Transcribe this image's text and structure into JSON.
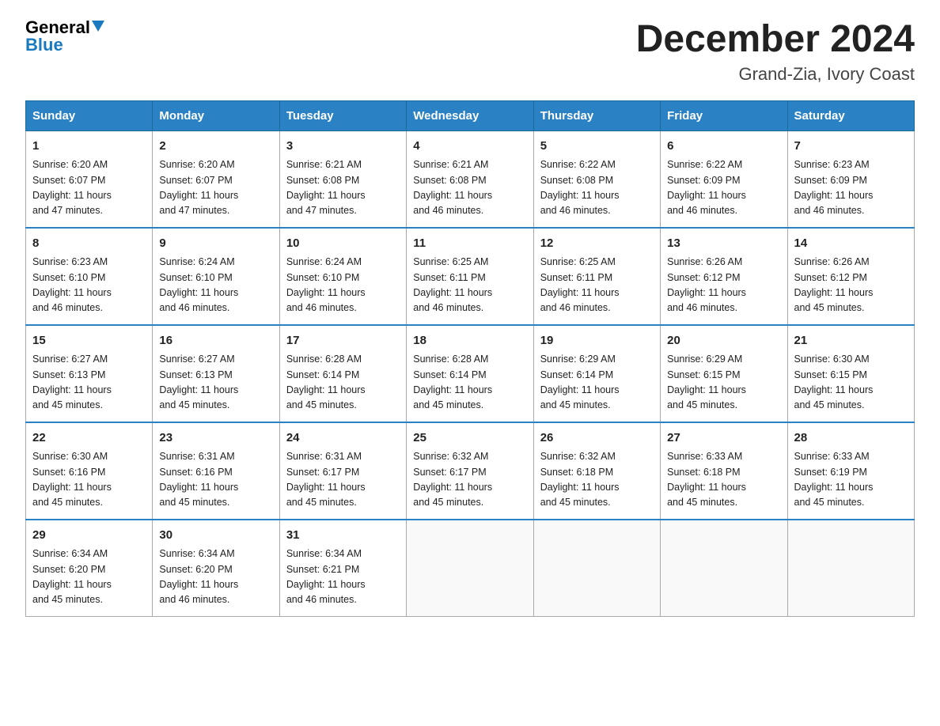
{
  "header": {
    "logo_general": "General",
    "logo_blue": "Blue",
    "month_title": "December 2024",
    "location": "Grand-Zia, Ivory Coast"
  },
  "weekdays": [
    "Sunday",
    "Monday",
    "Tuesday",
    "Wednesday",
    "Thursday",
    "Friday",
    "Saturday"
  ],
  "weeks": [
    [
      {
        "day": "1",
        "sunrise": "6:20 AM",
        "sunset": "6:07 PM",
        "daylight": "11 hours and 47 minutes."
      },
      {
        "day": "2",
        "sunrise": "6:20 AM",
        "sunset": "6:07 PM",
        "daylight": "11 hours and 47 minutes."
      },
      {
        "day": "3",
        "sunrise": "6:21 AM",
        "sunset": "6:08 PM",
        "daylight": "11 hours and 47 minutes."
      },
      {
        "day": "4",
        "sunrise": "6:21 AM",
        "sunset": "6:08 PM",
        "daylight": "11 hours and 46 minutes."
      },
      {
        "day": "5",
        "sunrise": "6:22 AM",
        "sunset": "6:08 PM",
        "daylight": "11 hours and 46 minutes."
      },
      {
        "day": "6",
        "sunrise": "6:22 AM",
        "sunset": "6:09 PM",
        "daylight": "11 hours and 46 minutes."
      },
      {
        "day": "7",
        "sunrise": "6:23 AM",
        "sunset": "6:09 PM",
        "daylight": "11 hours and 46 minutes."
      }
    ],
    [
      {
        "day": "8",
        "sunrise": "6:23 AM",
        "sunset": "6:10 PM",
        "daylight": "11 hours and 46 minutes."
      },
      {
        "day": "9",
        "sunrise": "6:24 AM",
        "sunset": "6:10 PM",
        "daylight": "11 hours and 46 minutes."
      },
      {
        "day": "10",
        "sunrise": "6:24 AM",
        "sunset": "6:10 PM",
        "daylight": "11 hours and 46 minutes."
      },
      {
        "day": "11",
        "sunrise": "6:25 AM",
        "sunset": "6:11 PM",
        "daylight": "11 hours and 46 minutes."
      },
      {
        "day": "12",
        "sunrise": "6:25 AM",
        "sunset": "6:11 PM",
        "daylight": "11 hours and 46 minutes."
      },
      {
        "day": "13",
        "sunrise": "6:26 AM",
        "sunset": "6:12 PM",
        "daylight": "11 hours and 46 minutes."
      },
      {
        "day": "14",
        "sunrise": "6:26 AM",
        "sunset": "6:12 PM",
        "daylight": "11 hours and 45 minutes."
      }
    ],
    [
      {
        "day": "15",
        "sunrise": "6:27 AM",
        "sunset": "6:13 PM",
        "daylight": "11 hours and 45 minutes."
      },
      {
        "day": "16",
        "sunrise": "6:27 AM",
        "sunset": "6:13 PM",
        "daylight": "11 hours and 45 minutes."
      },
      {
        "day": "17",
        "sunrise": "6:28 AM",
        "sunset": "6:14 PM",
        "daylight": "11 hours and 45 minutes."
      },
      {
        "day": "18",
        "sunrise": "6:28 AM",
        "sunset": "6:14 PM",
        "daylight": "11 hours and 45 minutes."
      },
      {
        "day": "19",
        "sunrise": "6:29 AM",
        "sunset": "6:14 PM",
        "daylight": "11 hours and 45 minutes."
      },
      {
        "day": "20",
        "sunrise": "6:29 AM",
        "sunset": "6:15 PM",
        "daylight": "11 hours and 45 minutes."
      },
      {
        "day": "21",
        "sunrise": "6:30 AM",
        "sunset": "6:15 PM",
        "daylight": "11 hours and 45 minutes."
      }
    ],
    [
      {
        "day": "22",
        "sunrise": "6:30 AM",
        "sunset": "6:16 PM",
        "daylight": "11 hours and 45 minutes."
      },
      {
        "day": "23",
        "sunrise": "6:31 AM",
        "sunset": "6:16 PM",
        "daylight": "11 hours and 45 minutes."
      },
      {
        "day": "24",
        "sunrise": "6:31 AM",
        "sunset": "6:17 PM",
        "daylight": "11 hours and 45 minutes."
      },
      {
        "day": "25",
        "sunrise": "6:32 AM",
        "sunset": "6:17 PM",
        "daylight": "11 hours and 45 minutes."
      },
      {
        "day": "26",
        "sunrise": "6:32 AM",
        "sunset": "6:18 PM",
        "daylight": "11 hours and 45 minutes."
      },
      {
        "day": "27",
        "sunrise": "6:33 AM",
        "sunset": "6:18 PM",
        "daylight": "11 hours and 45 minutes."
      },
      {
        "day": "28",
        "sunrise": "6:33 AM",
        "sunset": "6:19 PM",
        "daylight": "11 hours and 45 minutes."
      }
    ],
    [
      {
        "day": "29",
        "sunrise": "6:34 AM",
        "sunset": "6:20 PM",
        "daylight": "11 hours and 45 minutes."
      },
      {
        "day": "30",
        "sunrise": "6:34 AM",
        "sunset": "6:20 PM",
        "daylight": "11 hours and 46 minutes."
      },
      {
        "day": "31",
        "sunrise": "6:34 AM",
        "sunset": "6:21 PM",
        "daylight": "11 hours and 46 minutes."
      },
      null,
      null,
      null,
      null
    ]
  ],
  "labels": {
    "sunrise": "Sunrise:",
    "sunset": "Sunset:",
    "daylight": "Daylight:"
  }
}
